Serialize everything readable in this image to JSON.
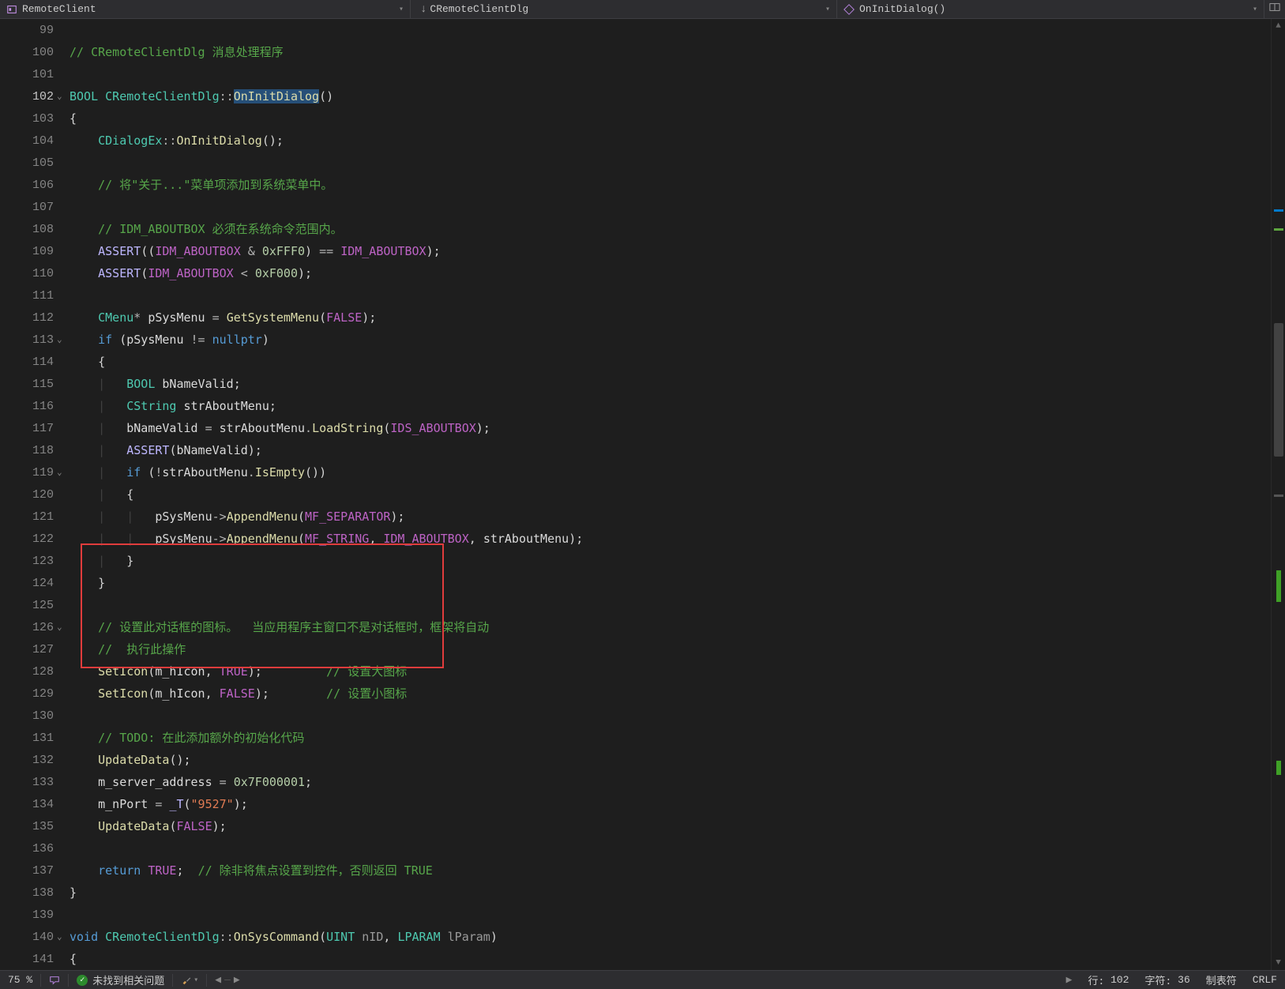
{
  "topbar": {
    "project": "RemoteClient",
    "class": "CRemoteClientDlg",
    "method": "OnInitDialog()"
  },
  "code": {
    "lines": [
      {
        "num": 99,
        "html": ""
      },
      {
        "num": 100,
        "html": "<span class='c-comment'>// CRemoteClientDlg 消息处理程序</span>"
      },
      {
        "num": 101,
        "html": ""
      },
      {
        "num": 102,
        "fold": "v",
        "current": true,
        "html": "<span class='c-type'>BOOL</span> <span class='c-type'>CRemoteClientDlg</span><span class='c-op'>::</span><span class='c-func c-caret'>OnInitDialog</span><span class='c-punct'>()</span>"
      },
      {
        "num": 103,
        "html": "<span class='c-punct'>{</span>"
      },
      {
        "num": 104,
        "html": "    <span class='c-type'>CDialogEx</span><span class='c-op'>::</span><span class='c-func'>OnInitDialog</span><span class='c-punct'>();</span>"
      },
      {
        "num": 105,
        "html": ""
      },
      {
        "num": 106,
        "html": "    <span class='c-comment'>// 将&quot;关于...&quot;菜单项添加到系统菜单中。</span>"
      },
      {
        "num": 107,
        "html": ""
      },
      {
        "num": 108,
        "html": "    <span class='c-comment'>// IDM_ABOUTBOX 必须在系统命令范围内。</span>"
      },
      {
        "num": 109,
        "html": "    <span class='c-macro'>ASSERT</span><span class='c-punct'>((</span><span class='c-macro2'>IDM_ABOUTBOX</span> <span class='c-op'>&amp;</span> <span class='c-number'>0xFFF0</span><span class='c-punct'>)</span> <span class='c-op'>==</span> <span class='c-macro2'>IDM_ABOUTBOX</span><span class='c-punct'>);</span>"
      },
      {
        "num": 110,
        "html": "    <span class='c-macro'>ASSERT</span><span class='c-punct'>(</span><span class='c-macro2'>IDM_ABOUTBOX</span> <span class='c-op'>&lt;</span> <span class='c-number'>0xF000</span><span class='c-punct'>);</span>"
      },
      {
        "num": 111,
        "html": ""
      },
      {
        "num": 112,
        "html": "    <span class='c-type'>CMenu</span><span class='c-op'>*</span> <span class='c-member'>pSysMenu</span> <span class='c-op'>=</span> <span class='c-func'>GetSystemMenu</span><span class='c-punct'>(</span><span class='c-macro2'>FALSE</span><span class='c-punct'>);</span>"
      },
      {
        "num": 113,
        "fold": "v",
        "html": "    <span class='c-keyword'>if</span> <span class='c-punct'>(</span><span class='c-member'>pSysMenu</span> <span class='c-op'>!=</span> <span class='c-keyword'>nullptr</span><span class='c-punct'>)</span>"
      },
      {
        "num": 114,
        "html": "    <span class='c-punct'>{</span>"
      },
      {
        "num": 115,
        "html": "    <span class='indent-guide'>|</span>   <span class='c-type'>BOOL</span> <span class='c-member'>bNameValid</span><span class='c-punct'>;</span>"
      },
      {
        "num": 116,
        "html": "    <span class='indent-guide'>|</span>   <span class='c-type'>CString</span> <span class='c-member'>strAboutMenu</span><span class='c-punct'>;</span>"
      },
      {
        "num": 117,
        "html": "    <span class='indent-guide'>|</span>   <span class='c-member'>bNameValid</span> <span class='c-op'>=</span> <span class='c-member'>strAboutMenu</span><span class='c-op'>.</span><span class='c-func'>LoadString</span><span class='c-punct'>(</span><span class='c-macro2'>IDS_ABOUTBOX</span><span class='c-punct'>);</span>"
      },
      {
        "num": 118,
        "html": "    <span class='indent-guide'>|</span>   <span class='c-macro'>ASSERT</span><span class='c-punct'>(</span><span class='c-member'>bNameValid</span><span class='c-punct'>);</span>"
      },
      {
        "num": 119,
        "fold": "v",
        "html": "    <span class='indent-guide'>|</span>   <span class='c-keyword'>if</span> <span class='c-punct'>(</span><span class='c-op'>!</span><span class='c-member'>strAboutMenu</span><span class='c-op'>.</span><span class='c-func'>IsEmpty</span><span class='c-punct'>())</span>"
      },
      {
        "num": 120,
        "html": "    <span class='indent-guide'>|</span>   <span class='c-punct'>{</span>"
      },
      {
        "num": 121,
        "html": "    <span class='indent-guide'>|</span>   <span class='indent-guide'>|</span>   <span class='c-member'>pSysMenu</span><span class='c-op'>-&gt;</span><span class='c-func'>AppendMenu</span><span class='c-punct'>(</span><span class='c-macro2'>MF_SEPARATOR</span><span class='c-punct'>);</span>"
      },
      {
        "num": 122,
        "html": "    <span class='indent-guide'>|</span>   <span class='indent-guide'>|</span>   <span class='c-member'>pSysMenu</span><span class='c-op'>-&gt;</span><span class='c-func'>AppendMenu</span><span class='c-punct'>(</span><span class='c-macro2'>MF_STRING</span><span class='c-punct'>,</span> <span class='c-macro2'>IDM_ABOUTBOX</span><span class='c-punct'>,</span> <span class='c-member'>strAboutMenu</span><span class='c-punct'>);</span>"
      },
      {
        "num": 123,
        "html": "    <span class='indent-guide'>|</span>   <span class='c-punct'>}</span>"
      },
      {
        "num": 124,
        "html": "    <span class='c-punct'>}</span>"
      },
      {
        "num": 125,
        "html": ""
      },
      {
        "num": 126,
        "fold": "v",
        "html": "    <span class='c-comment'>// 设置此对话框的图标。  当应用程序主窗口不是对话框时，框架将自动</span>"
      },
      {
        "num": 127,
        "html": "    <span class='c-comment'>//  执行此操作</span>"
      },
      {
        "num": 128,
        "html": "    <span class='c-func'>SetIcon</span><span class='c-punct'>(</span><span class='c-member'>m_hIcon</span><span class='c-punct'>,</span> <span class='c-macro2'>TRUE</span><span class='c-punct'>);</span>         <span class='c-comment'>// 设置大图标</span>"
      },
      {
        "num": 129,
        "html": "    <span class='c-func'>SetIcon</span><span class='c-punct'>(</span><span class='c-member'>m_hIcon</span><span class='c-punct'>,</span> <span class='c-macro2'>FALSE</span><span class='c-punct'>);</span>        <span class='c-comment'>// 设置小图标</span>"
      },
      {
        "num": 130,
        "html": ""
      },
      {
        "num": 131,
        "html": "    <span class='c-comment'>// TODO: 在此添加额外的初始化代码</span>"
      },
      {
        "num": 132,
        "html": "    <span class='c-func'>UpdateData</span><span class='c-punct'>();</span>"
      },
      {
        "num": 133,
        "html": "    <span class='c-member'>m_server_address</span> <span class='c-op'>=</span> <span class='c-number'>0x7F000001</span><span class='c-punct'>;</span>"
      },
      {
        "num": 134,
        "html": "    <span class='c-member'>m_nPort</span> <span class='c-op'>=</span> <span class='c-macro'>_T</span><span class='c-punct'>(</span><span class='c-string'>&quot;9527&quot;</span><span class='c-punct'>);</span>"
      },
      {
        "num": 135,
        "html": "    <span class='c-func'>UpdateData</span><span class='c-punct'>(</span><span class='c-macro2'>FALSE</span><span class='c-punct'>);</span>"
      },
      {
        "num": 136,
        "html": ""
      },
      {
        "num": 137,
        "html": "    <span class='c-keyword'>return</span> <span class='c-macro2'>TRUE</span><span class='c-punct'>;</span>  <span class='c-comment'>// 除非将焦点设置到控件，否则返回 TRUE</span>"
      },
      {
        "num": 138,
        "html": "<span class='c-punct'>}</span>"
      },
      {
        "num": 139,
        "html": ""
      },
      {
        "num": 140,
        "fold": "v",
        "html": "<span class='c-keyword'>void</span> <span class='c-type'>CRemoteClientDlg</span><span class='c-op'>::</span><span class='c-func'>OnSysCommand</span><span class='c-punct'>(</span><span class='c-type'>UINT</span> <span class='c-param'>nID</span><span class='c-punct'>,</span> <span class='c-type'>LPARAM</span> <span class='c-param'>lParam</span><span class='c-punct'>)</span>"
      },
      {
        "num": 141,
        "html": "<span class='c-punct'>{</span>"
      }
    ]
  },
  "statusbar": {
    "zoom": "75 %",
    "issues": "未找到相关问题",
    "lineLabel": "行:",
    "lineValue": "102",
    "charLabel": "字符:",
    "charValue": "36",
    "indent": "制表符",
    "lineEnding": "CRLF"
  }
}
